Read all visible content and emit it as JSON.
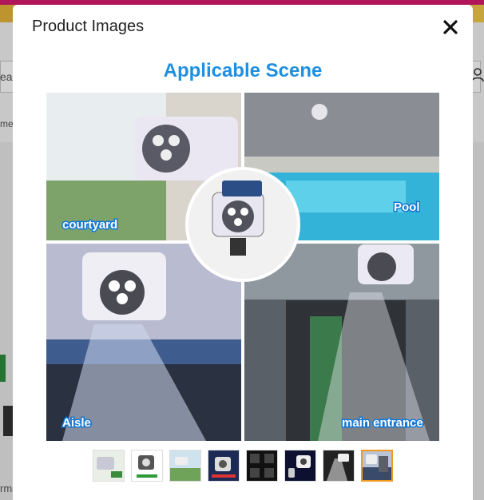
{
  "background_page": {
    "search_partial": "ear",
    "breadcrumb_partial": "mer",
    "footer_partial": "rma"
  },
  "modal": {
    "title": "Product Images",
    "close_label": "×",
    "main_image": {
      "headline": "Applicable Scene",
      "scene_labels": [
        "courtyard",
        "Pool",
        "Aisle",
        "main entrance"
      ]
    },
    "thumbnails": [
      {
        "icon": "solar-light-thumbnail",
        "active": false
      },
      {
        "icon": "solar-light-thumbnail",
        "active": false
      },
      {
        "icon": "solar-light-thumbnail",
        "active": false
      },
      {
        "icon": "solar-light-thumbnail",
        "active": false
      },
      {
        "icon": "solar-light-thumbnail",
        "active": false
      },
      {
        "icon": "solar-light-thumbnail",
        "active": false
      },
      {
        "icon": "solar-light-thumbnail",
        "active": false
      },
      {
        "icon": "solar-light-thumbnail",
        "active": true
      }
    ]
  },
  "colors": {
    "headline": "#1f8fe0",
    "label_bg": "#1478d4",
    "active_thumb_border": "#f29a1f"
  }
}
